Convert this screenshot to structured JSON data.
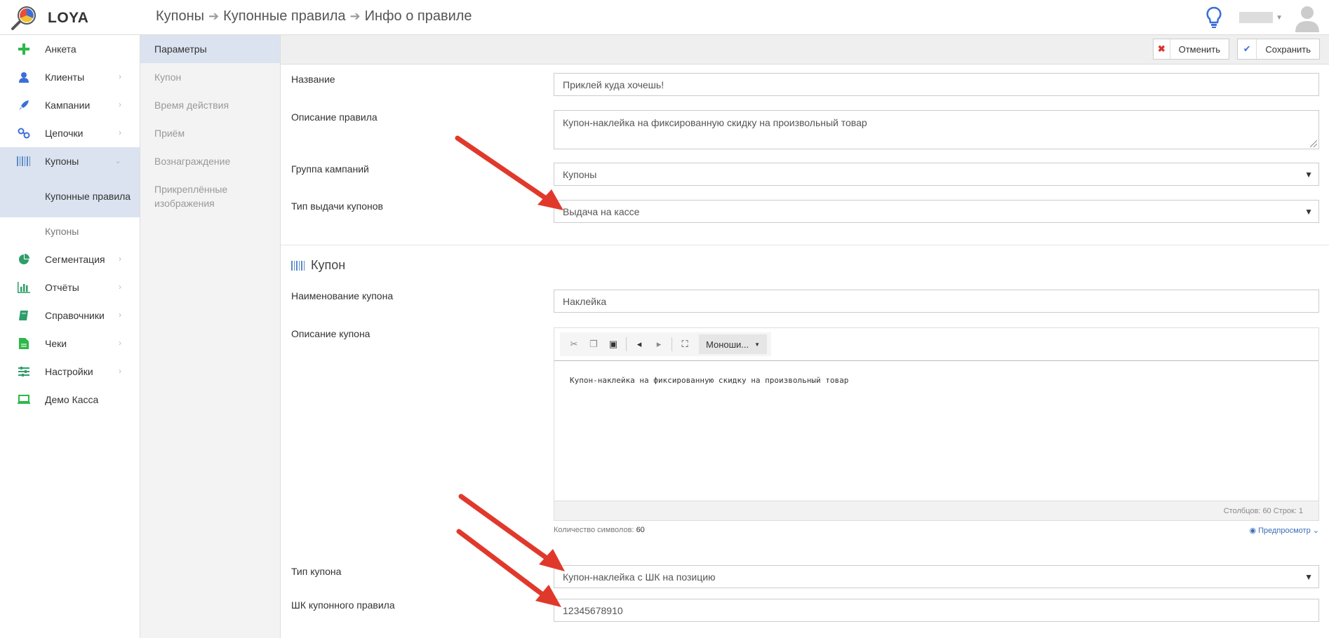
{
  "header": {
    "logo_text": "LOYA",
    "breadcrumb": [
      "Купоны",
      "Купонные правила",
      "Инфо о правиле"
    ]
  },
  "sidebar": {
    "items": [
      {
        "label": "Анкета",
        "icon": "plus-icon"
      },
      {
        "label": "Клиенты",
        "icon": "user-icon"
      },
      {
        "label": "Кампании",
        "icon": "rocket-icon"
      },
      {
        "label": "Цепочки",
        "icon": "chain-icon"
      },
      {
        "label": "Купоны",
        "icon": "barcode-icon"
      },
      {
        "label": "Сегментация",
        "icon": "pie-chart-icon"
      },
      {
        "label": "Отчёты",
        "icon": "bar-chart-icon"
      },
      {
        "label": "Справочники",
        "icon": "book-icon"
      },
      {
        "label": "Чеки",
        "icon": "receipt-icon"
      },
      {
        "label": "Настройки",
        "icon": "sliders-icon"
      },
      {
        "label": "Демо Касса",
        "icon": "laptop-icon"
      }
    ],
    "sub_items": [
      "Купонные правила",
      "Купоны"
    ]
  },
  "tabs": [
    "Параметры",
    "Купон",
    "Время действия",
    "Приём",
    "Вознаграждение",
    "Прикреплённые изображения"
  ],
  "toolbar": {
    "cancel_label": "Отменить",
    "save_label": "Сохранить"
  },
  "form": {
    "name_label": "Название",
    "name_value": "Приклей куда хочешь!",
    "desc_label": "Описание правила",
    "desc_value": "Купон-наклейка на фиксированную скидку на произвольный товар",
    "group_label": "Группа кампаний",
    "group_value": "Купоны",
    "issue_type_label": "Тип выдачи купонов",
    "issue_type_value": "Выдача на кассе"
  },
  "coupon": {
    "section_title": "Купон",
    "coupon_name_label": "Наименование купона",
    "coupon_name_value": "Наклейка",
    "coupon_desc_label": "Описание купона",
    "editor_font": "Моноши...",
    "editor_content": "Купон-наклейка на фиксированную скидку на произвольный товар",
    "editor_status": "Столбцов: 60 Строк: 1",
    "char_count_label": "Количество символов:",
    "char_count_value": "60",
    "preview_label": "Предпросмотр",
    "coupon_type_label": "Тип купона",
    "coupon_type_value": "Купон-наклейка с ШК на позицию",
    "barcode_label": "ШК купонного правила",
    "barcode_value": "12345678910"
  },
  "colors": {
    "accent": "#2f9e6a",
    "active_bg": "#dbe3f0",
    "arrow": "#e0392b",
    "link": "#3a6fb5"
  }
}
